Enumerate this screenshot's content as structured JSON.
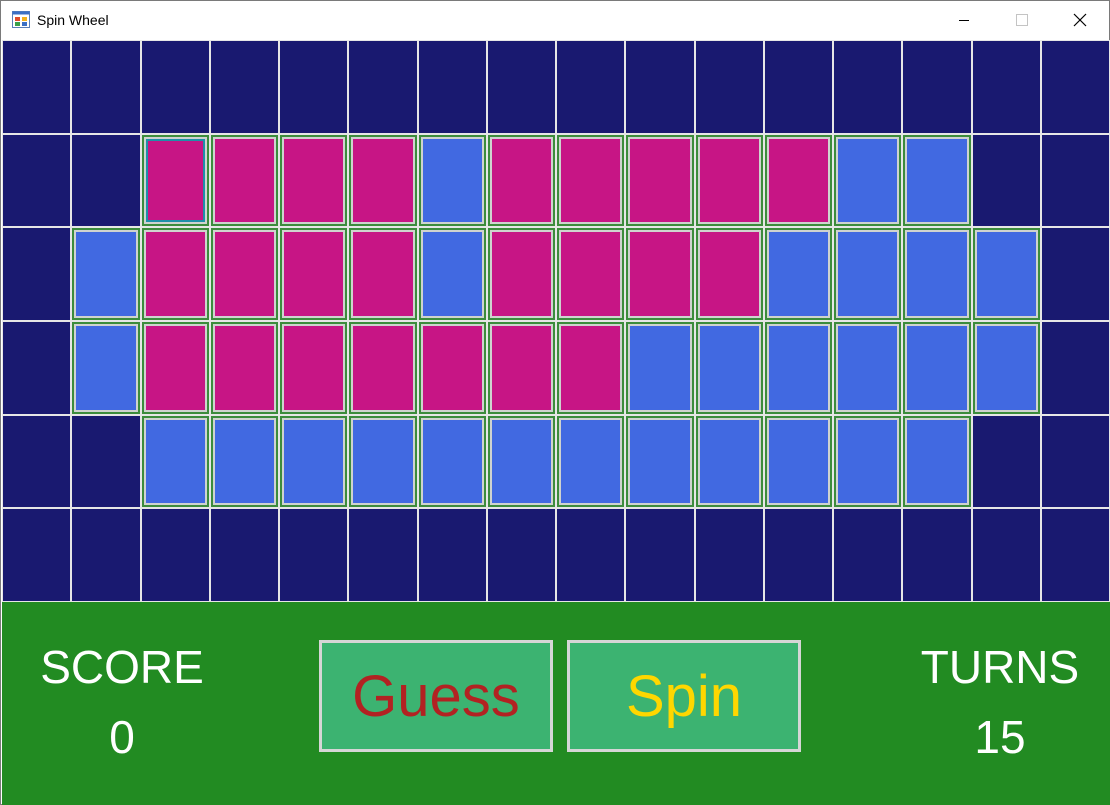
{
  "window": {
    "title": "Spin Wheel",
    "icon": "app-window-icon",
    "controls": [
      "minimize-icon",
      "maximize-icon",
      "close-icon"
    ]
  },
  "colors": {
    "empty": "#191970",
    "revealed": "#c71585",
    "hidden": "#4169e1",
    "gridline": "#e6e6e6",
    "panel": "#228b22",
    "button": "#3cb371",
    "guess_text": "#b22222",
    "spin_text": "#ffd700",
    "label_text": "#ffffff"
  },
  "board": {
    "columns": 16,
    "rows": 6,
    "selected": [
      1,
      2
    ],
    "cells": [
      "EEEEEEEEEEEEEEEE",
      "EERRRRHRRRRRHHEE",
      "EHRRRRHRRRRHHHHE",
      "EHRRRRRRRHHHHHHE",
      "EEHHHHHHHHHHHHEE",
      "EEEEEEEEEEEEEEEE"
    ]
  },
  "score": {
    "label": "SCORE",
    "value": "0"
  },
  "turns": {
    "label": "TURNS",
    "value": "15"
  },
  "buttons": {
    "guess": "Guess",
    "spin": "Spin"
  }
}
